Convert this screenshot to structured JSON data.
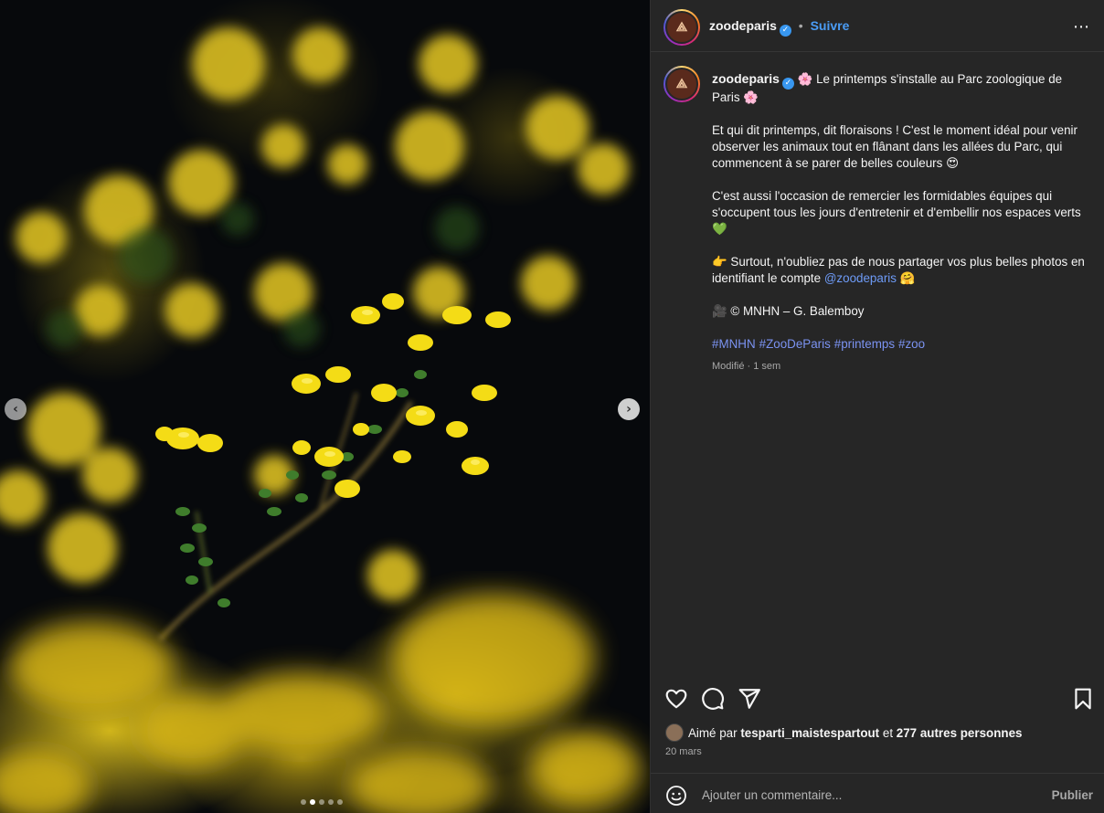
{
  "media": {
    "image_description": "Yellow flowering branch on dark background",
    "carousel": {
      "count": 5,
      "active_index": 1
    }
  },
  "post": {
    "author": "zoodeparis",
    "follow_label": "Suivre",
    "separator": "•",
    "more_icon": "⋯",
    "caption": {
      "line1_emoji_a": "🌸",
      "line1": "Le printemps s'installe au Parc zoologique de Paris",
      "line1_emoji_b": "🌸",
      "p2": "Et qui dit printemps, dit floraisons ! C'est le moment idéal pour venir observer les animaux tout en flânant dans les allées du Parc, qui commencent à se parer de belles couleurs",
      "p2_emoji": "😍",
      "p3": "C'est aussi l'occasion de remercier les formidables équipes qui s'occupent tous les jours d'entretenir et d'embellir nos espaces verts",
      "p3_emoji": "💚",
      "p4_emoji": "👉",
      "p4": "Surtout, n'oubliez pas de nous partager vos plus belles photos en identifiant le compte",
      "p4_mention": "@zoodeparis",
      "p4_emoji_end": "🤗",
      "p5_emoji": "🎥",
      "p5": "© MNHN – G. Balemboy",
      "hashtags": [
        "#MNHN",
        "#ZooDeParis",
        "#printemps",
        "#zoo"
      ]
    },
    "meta": "Modifié · 1 sem",
    "likes": {
      "prefix": "Aimé par",
      "user": "tesparti_maistespartout",
      "middle": "et",
      "others": "277 autres personnes"
    },
    "date": "20 mars"
  },
  "comment": {
    "placeholder": "Ajouter un commentaire...",
    "publish_label": "Publier"
  },
  "icons": {
    "like": "heart-icon",
    "comment": "comment-bubble-icon",
    "share": "paper-plane-icon",
    "save": "bookmark-icon",
    "emoji": "smiley-icon",
    "verified": "verified-badge-icon",
    "prev": "chevron-left-icon",
    "next": "chevron-right-icon"
  },
  "colors": {
    "panel_bg": "#262626",
    "link_blue": "#4a9cf5",
    "hashtag_blue": "#7b93f2",
    "muted": "#a8a8a8"
  }
}
